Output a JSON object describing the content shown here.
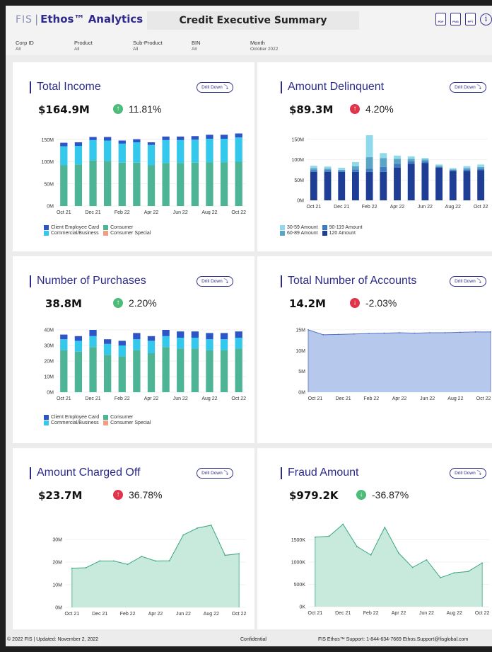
{
  "header": {
    "logo_fis": "FIS",
    "logo_sep": "|",
    "logo_name": "Ethos™ Analytics",
    "title": "Credit Executive Summary",
    "icons": [
      "pdf-icon",
      "png-icon",
      "ppt-icon",
      "info-icon"
    ],
    "icon_labels": {
      "pdf": "PDF",
      "png": "PNG",
      "ppt": "PPT",
      "info": "i"
    }
  },
  "filters": [
    {
      "label": "Corp ID",
      "value": "All"
    },
    {
      "label": "Product",
      "value": "All"
    },
    {
      "label": "Sub-Product",
      "value": "All"
    },
    {
      "label": "BIN",
      "value": "All"
    },
    {
      "label": "Month",
      "value": "October 2022"
    }
  ],
  "drill_label": "Drill Down ⤵",
  "colors": {
    "client_employee": "#2d55c8",
    "consumer": "#4db596",
    "commercial": "#33c8ec",
    "consumer_special": "#f0a080",
    "d30": "#8fdaea",
    "d60": "#5aa4c6",
    "d90": "#3e7cbf",
    "d120": "#1e3e96",
    "area_blue": "#b6c8ec",
    "area_blue_line": "#5470c6",
    "area_green": "#c8eadd",
    "area_green_line": "#3aa57e",
    "up_arrow": "#4dbb7a",
    "bad_arrow": "#e0344b"
  },
  "cards": {
    "total_income": {
      "title": "Total Income",
      "value": "$164.9M",
      "change": "11.81%",
      "arrow": "up"
    },
    "amount_delinquent": {
      "title": "Amount Delinquent",
      "value": "$89.3M",
      "change": "4.20%",
      "arrow": "bad-up"
    },
    "number_purchases": {
      "title": "Number of Purchases",
      "value": "38.8M",
      "change": "2.20%",
      "arrow": "up"
    },
    "total_accounts": {
      "title": "Total Number of Accounts",
      "value": "14.2M",
      "change": "-2.03%",
      "arrow": "bad-down"
    },
    "charged_off": {
      "title": "Amount Charged Off",
      "value": "$23.7M",
      "change": "36.78%",
      "arrow": "bad-up"
    },
    "fraud": {
      "title": "Fraud Amount",
      "value": "$979.2K",
      "change": "-36.87%",
      "arrow": "down"
    }
  },
  "legends": {
    "income": [
      "Client Employee Card",
      "Consumer",
      "Commercial/Business",
      "Consumer Special"
    ],
    "delinquent": [
      "30-59 Amount",
      "90-119 Amount",
      "60-89 Amount",
      "120 Amount"
    ],
    "purchases": [
      "Client Employee Card",
      "Consumer",
      "Commercial/Business",
      "Consumer Special"
    ]
  },
  "chart_data": [
    {
      "id": "total_income",
      "type": "bar",
      "stacked": true,
      "categories": [
        "Oct 21",
        "Nov 21",
        "Dec 21",
        "Jan 22",
        "Feb 22",
        "Mar 22",
        "Apr 22",
        "May 22",
        "Jun 22",
        "Jul 22",
        "Aug 22",
        "Sep 22",
        "Oct 22"
      ],
      "x_tick_labels": [
        "Oct 21",
        "Dec 21",
        "Feb 22",
        "Apr 22",
        "Jun 22",
        "Aug 22",
        "Oct 22"
      ],
      "y_ticks": [
        "0M",
        "50M",
        "100M",
        "150M"
      ],
      "ylim": [
        0,
        160
      ],
      "series": [
        {
          "name": "Consumer",
          "values": [
            92,
            94,
            103,
            102,
            98,
            98,
            92,
            97,
            97,
            98,
            99,
            99,
            100
          ]
        },
        {
          "name": "Commercial/Business",
          "values": [
            43,
            42,
            46,
            46,
            43,
            46,
            46,
            52,
            52,
            52,
            53,
            53,
            55
          ]
        },
        {
          "name": "Client Employee Card",
          "values": [
            8,
            8,
            7,
            8,
            7,
            7,
            6,
            8,
            8,
            8,
            9,
            9,
            9
          ]
        },
        {
          "name": "Consumer Special",
          "values": [
            0,
            0,
            0,
            0,
            0,
            0,
            0,
            0,
            0,
            0,
            0,
            0,
            0
          ]
        }
      ]
    },
    {
      "id": "amount_delinquent",
      "type": "bar",
      "stacked": true,
      "categories": [
        "Oct 21",
        "Nov 21",
        "Dec 21",
        "Jan 22",
        "Feb 22",
        "Mar 22",
        "Apr 22",
        "May 22",
        "Jun 22",
        "Jul 22",
        "Aug 22",
        "Sep 22",
        "Oct 22"
      ],
      "x_tick_labels": [
        "Oct 21",
        "Dec 21",
        "Feb 22",
        "Apr 22",
        "Jun 22",
        "Aug 22",
        "Oct 22"
      ],
      "y_ticks": [
        "0M",
        "50M",
        "100M",
        "150M"
      ],
      "ylim": [
        0,
        160
      ],
      "series": [
        {
          "name": "120 Amount",
          "values": [
            70,
            70,
            70,
            70,
            70,
            70,
            80,
            90,
            92,
            80,
            72,
            72,
            74
          ]
        },
        {
          "name": "90-119 Amount",
          "values": [
            4,
            4,
            2,
            6,
            8,
            12,
            10,
            6,
            4,
            2,
            2,
            4,
            4
          ]
        },
        {
          "name": "60-89 Amount",
          "values": [
            5,
            4,
            3,
            8,
            28,
            22,
            12,
            6,
            4,
            3,
            2,
            3,
            4
          ]
        },
        {
          "name": "30-59 Amount",
          "values": [
            6,
            5,
            5,
            10,
            54,
            12,
            8,
            6,
            4,
            3,
            3,
            5,
            6
          ]
        }
      ]
    },
    {
      "id": "number_purchases",
      "type": "bar",
      "stacked": true,
      "categories": [
        "Oct 21",
        "Nov 21",
        "Dec 21",
        "Jan 22",
        "Feb 22",
        "Mar 22",
        "Apr 22",
        "May 22",
        "Jun 22",
        "Jul 22",
        "Aug 22",
        "Sep 22",
        "Oct 22"
      ],
      "x_tick_labels": [
        "Oct 21",
        "Dec 21",
        "Feb 22",
        "Apr 22",
        "Jun 22",
        "Aug 22",
        "Oct 22"
      ],
      "y_ticks": [
        "0M",
        "10M",
        "20M",
        "30M",
        "40M"
      ],
      "ylim": [
        0,
        40
      ],
      "series": [
        {
          "name": "Consumer",
          "values": [
            27,
            26,
            29,
            24,
            23,
            27,
            25,
            29,
            28,
            28,
            27,
            27,
            28
          ]
        },
        {
          "name": "Commercial/Business",
          "values": [
            7,
            7,
            7,
            7,
            7,
            7,
            8,
            7,
            7,
            7,
            7,
            7,
            7
          ]
        },
        {
          "name": "Client Employee Card",
          "values": [
            3,
            3,
            4,
            3,
            3,
            4,
            3,
            4,
            4,
            4,
            4,
            4,
            4
          ]
        },
        {
          "name": "Consumer Special",
          "values": [
            0,
            0,
            0,
            0,
            0,
            0,
            0,
            0,
            0,
            0,
            0,
            0,
            0
          ]
        }
      ]
    },
    {
      "id": "total_accounts",
      "type": "area",
      "categories": [
        "Oct 21",
        "Nov 21",
        "Dec 21",
        "Jan 22",
        "Feb 22",
        "Mar 22",
        "Apr 22",
        "May 22",
        "Jun 22",
        "Jul 22",
        "Aug 22",
        "Sep 22",
        "Oct 22"
      ],
      "x_tick_labels": [
        "Oct 21",
        "Dec 21",
        "Feb 22",
        "Apr 22",
        "Jun 22",
        "Aug 22",
        "Oct 22"
      ],
      "y_ticks": [
        "0M",
        "5M",
        "10M",
        "15M"
      ],
      "ylim": [
        0,
        16
      ],
      "values": [
        15.0,
        13.8,
        13.9,
        14.0,
        14.1,
        14.2,
        14.3,
        14.2,
        14.3,
        14.3,
        14.4,
        14.5,
        14.5
      ]
    },
    {
      "id": "charged_off",
      "type": "area",
      "categories": [
        "Oct 21",
        "Nov 21",
        "Dec 21",
        "Jan 22",
        "Feb 22",
        "Mar 22",
        "Apr 22",
        "May 22",
        "Jun 22",
        "Jul 22",
        "Aug 22",
        "Sep 22",
        "Oct 22"
      ],
      "x_tick_labels": [
        "Oct 21",
        "Dec 21",
        "Feb 22",
        "Apr 22",
        "Jun 22",
        "Aug 22",
        "Oct 22"
      ],
      "y_ticks": [
        "0M",
        "10M",
        "20M",
        "30M"
      ],
      "ylim": [
        0,
        40
      ],
      "values": [
        17.3,
        17.5,
        20.5,
        20.5,
        19.0,
        22.5,
        20.5,
        20.6,
        32.0,
        35.0,
        36.3,
        23.0,
        23.7
      ]
    },
    {
      "id": "fraud",
      "type": "area",
      "categories": [
        "Oct 21",
        "Nov 21",
        "Dec 21",
        "Jan 22",
        "Feb 22",
        "Mar 22",
        "Apr 22",
        "May 22",
        "Jun 22",
        "Jul 22",
        "Aug 22",
        "Sep 22",
        "Oct 22"
      ],
      "x_tick_labels": [
        "Oct 21",
        "Dec 21",
        "Feb 22",
        "Apr 22",
        "Jun 22",
        "Aug 22",
        "Oct 22"
      ],
      "y_ticks": [
        "0K",
        "500K",
        "1000K",
        "1500K"
      ],
      "ylim": [
        0,
        2000
      ],
      "values": [
        1560,
        1580,
        1850,
        1350,
        1160,
        1780,
        1200,
        880,
        1050,
        650,
        760,
        790,
        980
      ]
    }
  ],
  "footer": {
    "left": "© 2022 FIS | Updated: November 2, 2022",
    "center": "Confidential",
    "right": "FIS Ethos™  Support: 1-844-634-7669  Ethos.Support@fisglobal.com"
  }
}
